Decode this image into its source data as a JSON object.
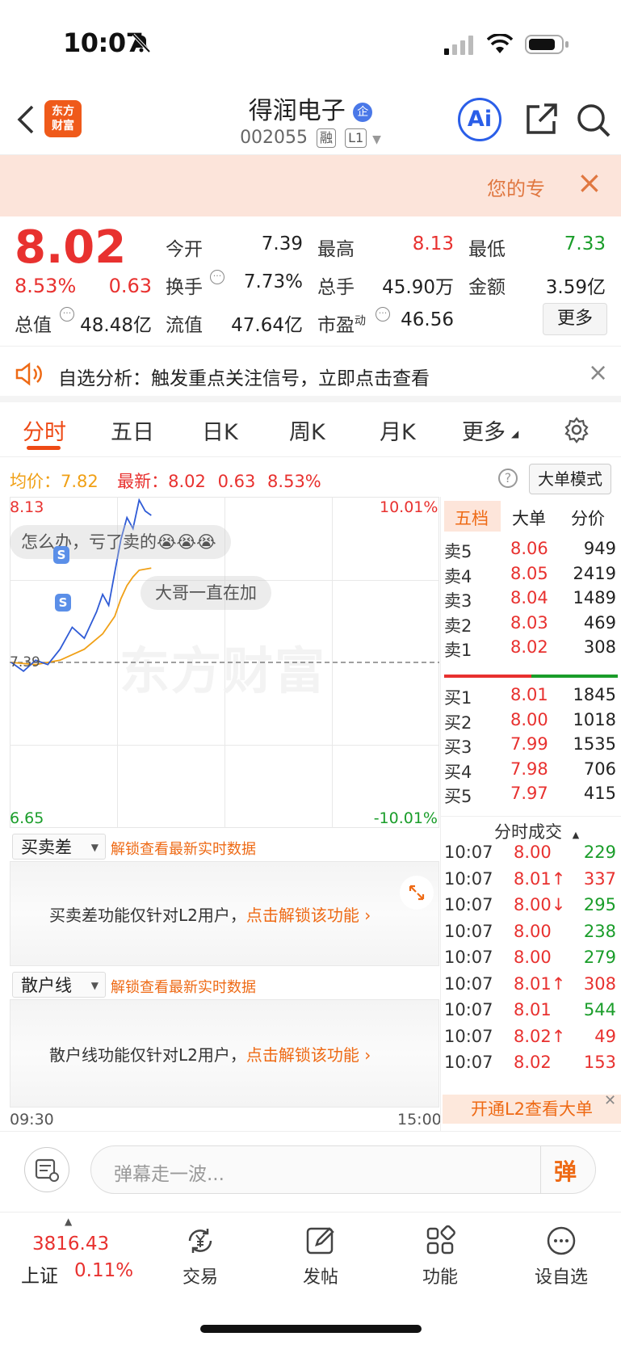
{
  "status": {
    "time": "10:07"
  },
  "header": {
    "logo": "东方\n财富",
    "name": "得润电子",
    "code": "002055",
    "tag1": "融",
    "tag2": "L1",
    "ai": "Ai"
  },
  "banner": {
    "text": "您的专",
    "close": "×"
  },
  "quote": {
    "price": "8.02",
    "pct": "8.53%",
    "chg": "0.63",
    "open_l": "今开",
    "open_v": "7.39",
    "high_l": "最高",
    "high_v": "8.13",
    "low_l": "最低",
    "low_v": "7.33",
    "turn_l": "换手",
    "turn_v": "7.73%",
    "vol_l": "总手",
    "vol_v": "45.90万",
    "amt_l": "金额",
    "amt_v": "3.59亿",
    "mcap_l": "总值",
    "mcap_v": "48.48亿",
    "float_l": "流值",
    "float_v": "47.64亿",
    "pe_l": "市盈",
    "pe_sup": "动",
    "pe_v": "46.56",
    "more": "更多"
  },
  "notice": {
    "text": "自选分析：触发重点关注信号，立即点击查看",
    "close": "×"
  },
  "tabs": [
    "分时",
    "五日",
    "日K",
    "周K",
    "月K",
    "更多"
  ],
  "infobar": {
    "avg_l": "均价：",
    "avg_v": "7.82",
    "new_l": "最新：",
    "new_v": "8.02",
    "chg": "0.63",
    "pct": "8.53%",
    "mode": "大单模式"
  },
  "chart": {
    "ymax": "8.13",
    "ymin": "6.65",
    "pmax": "10.01%",
    "pmin": "-10.01%",
    "prev": "7.39",
    "bullet1": "怎么办，亏了卖的😭😭😭",
    "bullet2": "大哥一直在加",
    "watermark": "东方财富",
    "t_start": "09:30",
    "t_end": "15:00",
    "price_pts": [
      [
        0,
        7.39
      ],
      [
        2,
        7.35
      ],
      [
        4,
        7.4
      ],
      [
        6,
        7.38
      ],
      [
        8,
        7.45
      ],
      [
        10,
        7.55
      ],
      [
        12,
        7.5
      ],
      [
        14,
        7.62
      ],
      [
        15,
        7.7
      ],
      [
        16,
        7.65
      ],
      [
        17,
        7.8
      ],
      [
        18,
        7.95
      ],
      [
        19,
        8.05
      ],
      [
        20,
        8.0
      ],
      [
        21,
        8.13
      ],
      [
        22,
        8.08
      ],
      [
        23,
        8.06
      ]
    ],
    "avg_pts": [
      [
        0,
        7.39
      ],
      [
        4,
        7.38
      ],
      [
        8,
        7.4
      ],
      [
        12,
        7.45
      ],
      [
        15,
        7.52
      ],
      [
        17,
        7.6
      ],
      [
        18,
        7.68
      ],
      [
        19,
        7.74
      ],
      [
        20,
        7.78
      ],
      [
        21,
        7.81
      ],
      [
        23,
        7.82
      ]
    ]
  },
  "panel1": {
    "select": "买卖差",
    "unlock": "解锁查看最新实时数据",
    "msg": "买卖差功能仅针对L2用户，",
    "link": "点击解锁该功能"
  },
  "panel2": {
    "select": "散户线",
    "unlock": "解锁查看最新实时数据",
    "msg": "散户线功能仅针对L2用户，",
    "link": "点击解锁该功能"
  },
  "orderbook": {
    "tabs": [
      "五档",
      "大单",
      "分价"
    ],
    "asks": [
      {
        "l": "卖5",
        "p": "8.06",
        "v": "949"
      },
      {
        "l": "卖4",
        "p": "8.05",
        "v": "2419"
      },
      {
        "l": "卖3",
        "p": "8.04",
        "v": "1489"
      },
      {
        "l": "卖2",
        "p": "8.03",
        "v": "469"
      },
      {
        "l": "卖1",
        "p": "8.02",
        "v": "308"
      }
    ],
    "bids": [
      {
        "l": "买1",
        "p": "8.01",
        "v": "1845"
      },
      {
        "l": "买2",
        "p": "8.00",
        "v": "1018"
      },
      {
        "l": "买3",
        "p": "7.99",
        "v": "1535"
      },
      {
        "l": "买4",
        "p": "7.98",
        "v": "706"
      },
      {
        "l": "买5",
        "p": "7.97",
        "v": "415"
      }
    ],
    "trades_title": "分时成交",
    "trades": [
      {
        "t": "10:07",
        "p": "8.00",
        "v": "229",
        "c": "green"
      },
      {
        "t": "10:07",
        "p": "8.01↑",
        "v": "337",
        "c": "red"
      },
      {
        "t": "10:07",
        "p": "8.00↓",
        "v": "295",
        "c": "green"
      },
      {
        "t": "10:07",
        "p": "8.00",
        "v": "238",
        "c": "green"
      },
      {
        "t": "10:07",
        "p": "8.00",
        "v": "279",
        "c": "green"
      },
      {
        "t": "10:07",
        "p": "8.01↑",
        "v": "308",
        "c": "red"
      },
      {
        "t": "10:07",
        "p": "8.01",
        "v": "544",
        "c": "green"
      },
      {
        "t": "10:07",
        "p": "8.02↑",
        "v": "49",
        "c": "red"
      },
      {
        "t": "10:07",
        "p": "8.02",
        "v": "153",
        "c": "red"
      }
    ],
    "l2": "开通L2查看大单"
  },
  "danmu": {
    "placeholder": "弹幕走一波...",
    "btn": "弹"
  },
  "bottom": {
    "index_v": "3816.43",
    "index_n": "上证",
    "index_p": "0.11%",
    "trade": "交易",
    "post": "发帖",
    "func": "功能",
    "watch": "设自选"
  }
}
